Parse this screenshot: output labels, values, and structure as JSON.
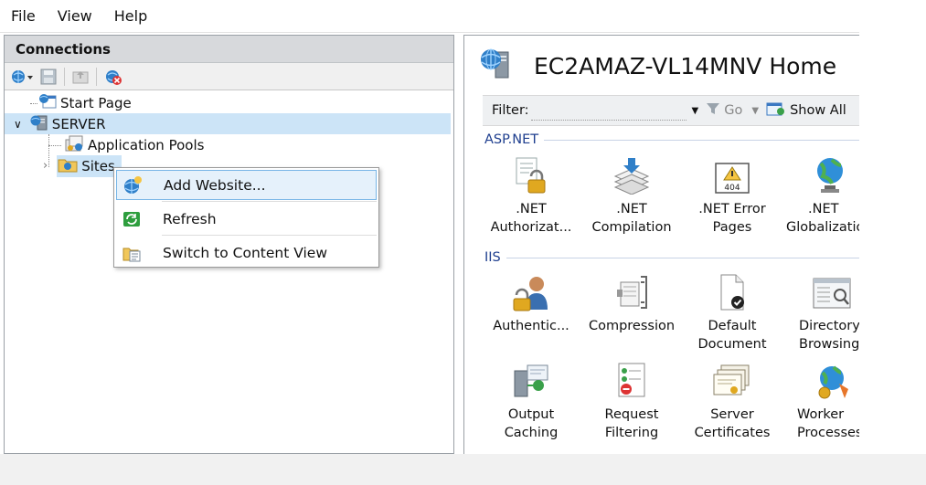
{
  "menu": [
    {
      "label": "File",
      "name": "menu-file"
    },
    {
      "label": "View",
      "name": "menu-view"
    },
    {
      "label": "Help",
      "name": "menu-help"
    }
  ],
  "connections": {
    "title": "Connections",
    "tree": {
      "start_page": "Start Page",
      "server": "SERVER",
      "app_pools": "Application Pools",
      "sites": "Sites"
    }
  },
  "context_menu": {
    "items": [
      {
        "label": "Add Website...",
        "icon": "globe-add-icon"
      },
      {
        "label": "Refresh",
        "icon": "refresh-icon"
      },
      {
        "label": "Switch to Content View",
        "icon": "content-view-icon"
      }
    ]
  },
  "main": {
    "title": "EC2AMAZ-VL14MNV Home",
    "filter_label": "Filter:",
    "go_label": "Go",
    "show_all_label": "Show All",
    "groups": [
      {
        "title": "ASP.NET",
        "features": [
          {
            "line1": ".NET",
            "line2": "Authorizat...",
            "icon": "net-authorization-icon"
          },
          {
            "line1": ".NET",
            "line2": "Compilation",
            "icon": "net-compilation-icon"
          },
          {
            "line1": ".NET Error",
            "line2": "Pages",
            "icon": "net-error-pages-icon",
            "badge": "404"
          },
          {
            "line1": ".NET",
            "line2": "Globalization",
            "icon": "net-globalization-icon"
          }
        ]
      },
      {
        "title": "IIS",
        "features": [
          {
            "line1": "Authentic...",
            "line2": "",
            "icon": "authentication-icon"
          },
          {
            "line1": "Compression",
            "line2": "",
            "icon": "compression-icon"
          },
          {
            "line1": "Default",
            "line2": "Document",
            "icon": "default-document-icon"
          },
          {
            "line1": "Directory",
            "line2": "Browsing",
            "icon": "directory-browsing-icon"
          },
          {
            "line1": "Output",
            "line2": "Caching",
            "icon": "output-caching-icon"
          },
          {
            "line1": "Request",
            "line2": "Filtering",
            "icon": "request-filtering-icon"
          },
          {
            "line1": "Server",
            "line2": "Certificates",
            "icon": "server-certificates-icon"
          },
          {
            "line1": "Worker",
            "line2": "Processes",
            "icon": "worker-processes-icon"
          }
        ]
      }
    ]
  }
}
